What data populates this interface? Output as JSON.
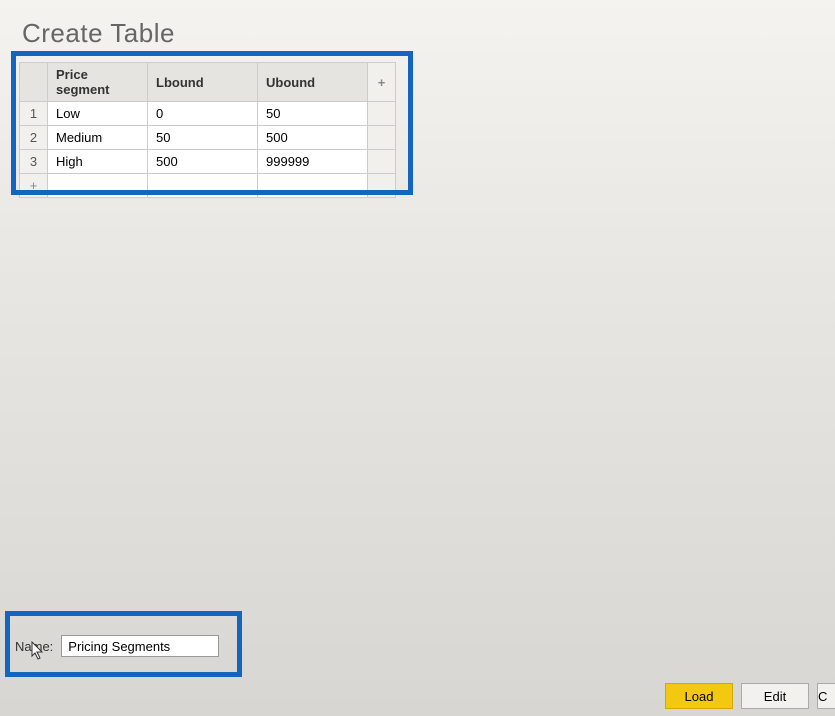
{
  "header": {
    "title": "Create Table"
  },
  "table": {
    "columns": {
      "segment": "Price segment",
      "lbound": "Lbound",
      "ubound": "Ubound",
      "add": "+"
    },
    "rows": [
      {
        "num": "1",
        "segment": "Low",
        "lbound": "0",
        "ubound": "50"
      },
      {
        "num": "2",
        "segment": "Medium",
        "lbound": "50",
        "ubound": "500"
      },
      {
        "num": "3",
        "segment": "High",
        "lbound": "500",
        "ubound": "999999"
      }
    ],
    "addRowLabel": "+"
  },
  "nameField": {
    "label": "Name:",
    "value": "Pricing Segments"
  },
  "buttons": {
    "load": "Load",
    "edit": "Edit",
    "cancel": "C"
  }
}
